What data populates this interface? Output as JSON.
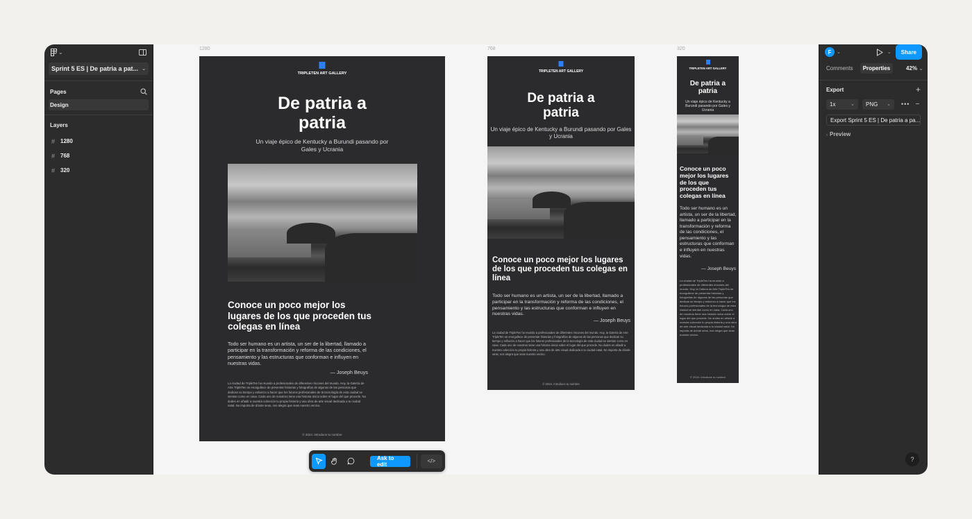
{
  "left_panel": {
    "file_title": "Sprint 5 ES | De patria a pat...",
    "pages_header": "Pages",
    "pages": [
      "Design"
    ],
    "layers_header": "Layers",
    "layers": [
      "1280",
      "768",
      "320"
    ]
  },
  "canvas": {
    "frame_labels": [
      "1280",
      "768",
      "320"
    ],
    "site": {
      "gallery": "TRIPLETEN ART GALLERY",
      "title": "De patria a patria",
      "subtitle": "Un viaje épico de Kentucky a Burundi pasando por Gales y Ucrania",
      "section_title": "Conoce un poco mejor los lugares de los que proceden tus colegas en línea",
      "quote": "Todo ser humano es un artista, un ser de la libertad, llamado a participar en la transformación y reforma de las condiciones, el pensamiento y las estructuras que conforman e influyen en nuestras vidas.",
      "author": "— Joseph Beuys",
      "body": "La ciudad de TripleTen ha reunido a profesionales de diferentes rincones del mundo. Hoy, la Galería de Arte TripleTen se enorgullece de presentar historias y fotografías de algunas de las personas que dedican su tiempo y esfuerzo a hacer que los futuros profesionales de la tecnología de esta ciudad se sientan como en casa. Cada uno de nosotros tiene una historia única sobre el lugar del que procede. No dudes en añadir a nuestra colección tu propia historia y una obra de arte visual dedicada a tu ciudad natal. No importa de dónde seas, nos alegra que seas nuestro vecino.",
      "footer": "© 2024. Introduce tu nombre"
    }
  },
  "toolbar": {
    "ask_label": "Ask to edit"
  },
  "right_panel": {
    "avatar_letter": "F",
    "share_label": "Share",
    "tabs": [
      "Comments",
      "Properties"
    ],
    "zoom": "42%",
    "export_header": "Export",
    "scale": "1x",
    "format": "PNG",
    "export_button": "Export Sprint 5 ES | De patria a pa...",
    "preview_label": "Preview"
  },
  "colors": {
    "accent": "#0d99ff",
    "logo_blue": "#2d7ff9",
    "frame_bg": "#2b2b2d",
    "panel_bg": "#2c2c2c"
  }
}
